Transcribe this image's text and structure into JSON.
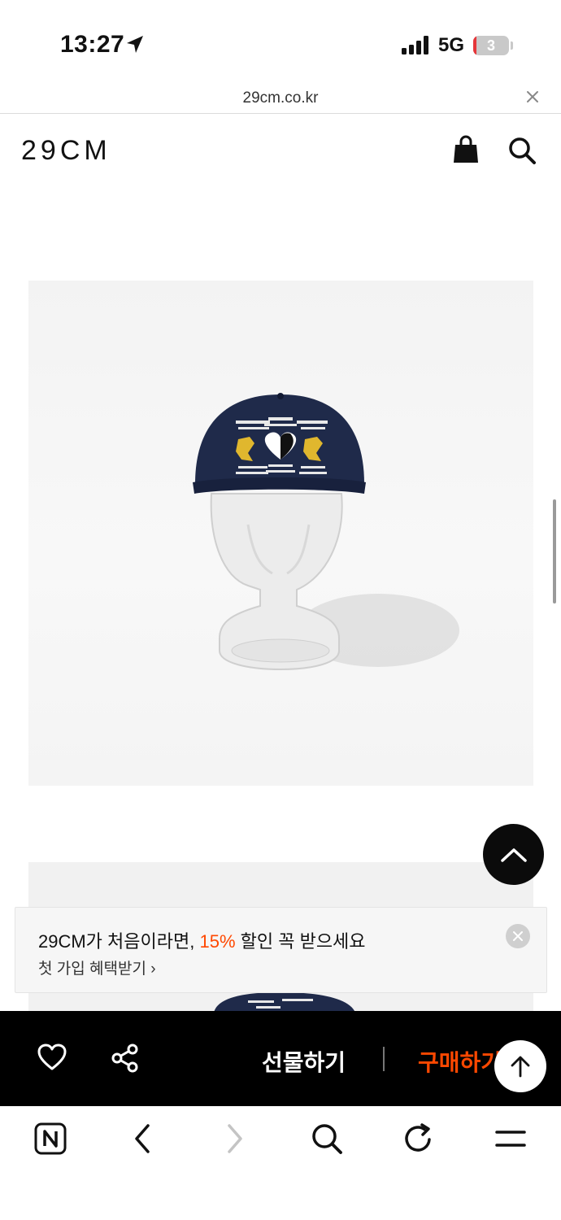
{
  "status_bar": {
    "time": "13:27",
    "network": "5G",
    "battery": "3",
    "location_icon": "location-arrow-icon",
    "signal_icon": "signal-bars-icon"
  },
  "browser": {
    "url": "29cm.co.kr",
    "close_icon": "close-icon"
  },
  "header": {
    "logo": "29CM",
    "bag_icon": "shopping-bag-icon",
    "search_icon": "search-icon"
  },
  "product": {
    "image_1": "navy-cap-on-glass-mannequin",
    "image_2": "navy-cap-partial"
  },
  "promo": {
    "prefix": "29CM가 처음이라면, ",
    "highlight": "15%",
    "suffix": " 할인 꼭 받으세요",
    "cta": "첫 가입 혜택받기",
    "highlight_color": "#ff4800"
  },
  "purchase_bar": {
    "gift_label": "선물하기",
    "buy_label": "구매하기",
    "heart_icon": "heart-icon",
    "share_icon": "share-icon",
    "buy_color": "#ff4800"
  },
  "toolbar": {
    "items": [
      "naver-home-icon",
      "back-icon",
      "forward-icon",
      "search-icon",
      "reload-icon",
      "menu-icon"
    ]
  }
}
